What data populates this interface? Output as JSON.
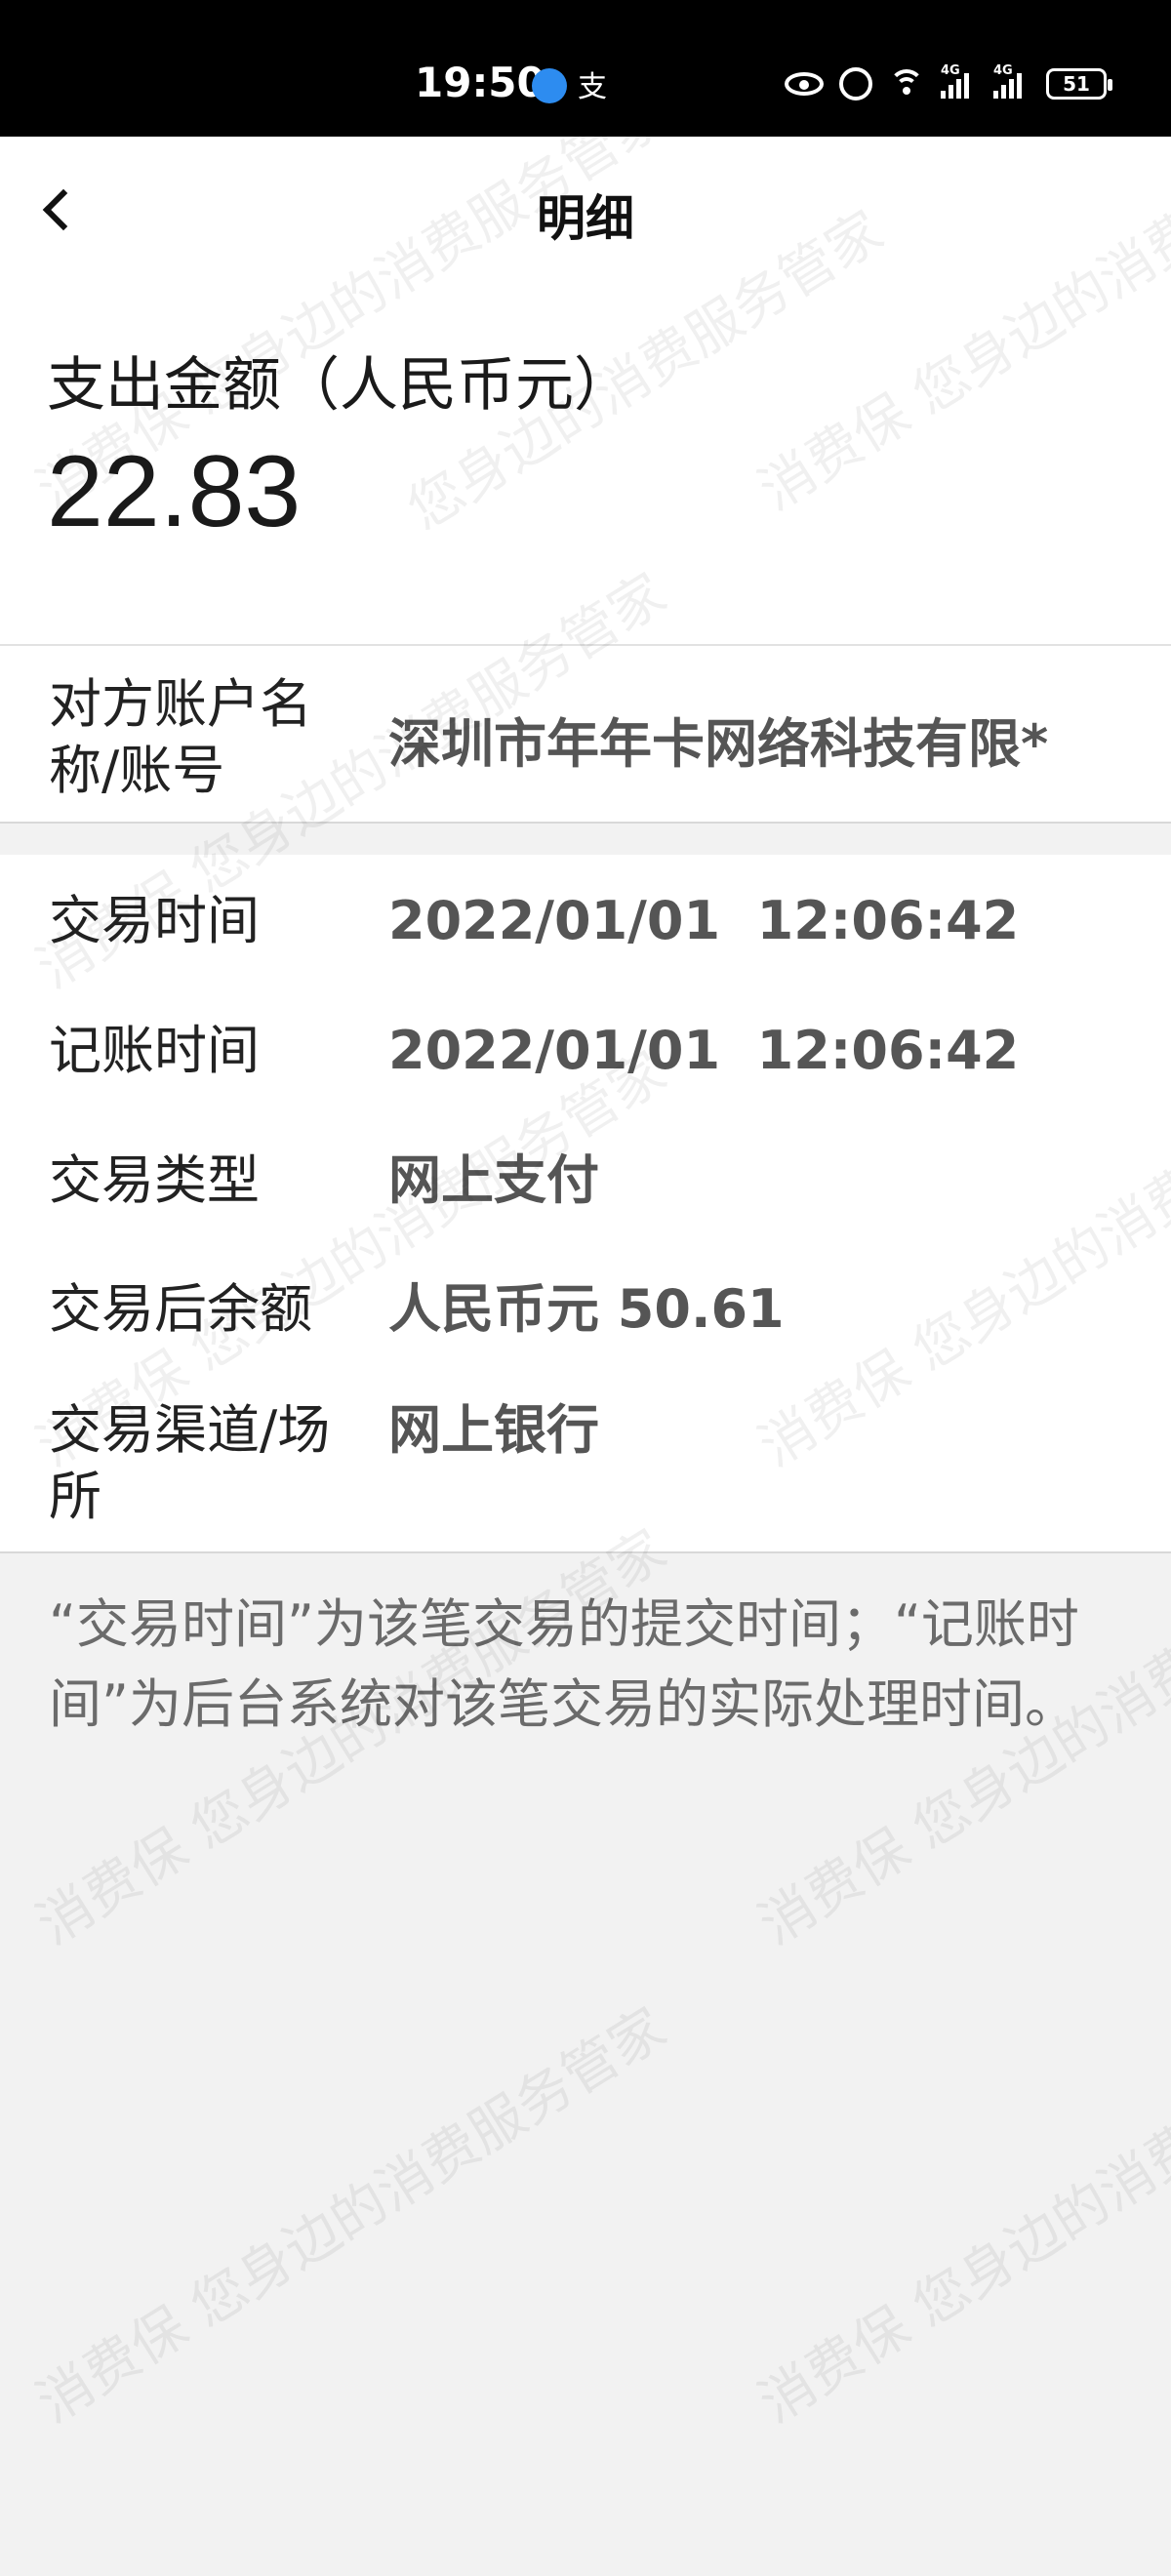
{
  "status_bar": {
    "time": "19:50",
    "alipay_glyph": "支",
    "signal_1_label": "4G",
    "signal_2_label": "4G",
    "battery": "51",
    "icons": [
      "eye-icon",
      "alarm-icon",
      "wifi-icon",
      "signal-icon",
      "signal-icon",
      "battery-icon"
    ]
  },
  "header": {
    "title": "明细",
    "back_icon": "chevron-left-icon"
  },
  "amount": {
    "label": "支出金额（人民币元）",
    "value": "22.83"
  },
  "counterparty": {
    "label": "对方账户名称/账号",
    "value": "深圳市年年卡网络科技有限*"
  },
  "details": [
    {
      "label": "交易时间",
      "value": "2022/01/01  12:06:42"
    },
    {
      "label": "记账时间",
      "value": "2022/01/01  12:06:42"
    },
    {
      "label": "交易类型",
      "value": "网上支付"
    },
    {
      "label": "交易后余额",
      "value": "人民币元 50.61"
    },
    {
      "label": "交易渠道/场所",
      "value": "网上银行"
    }
  ],
  "note": "“交易时间”为该笔交易的提交时间；“记账时间”为后台系统对该笔交易的实际处理时间。",
  "watermark": {
    "text_a": "消费保 您身边的消费服务管家",
    "text_b": "您身边的消费服务管家"
  }
}
